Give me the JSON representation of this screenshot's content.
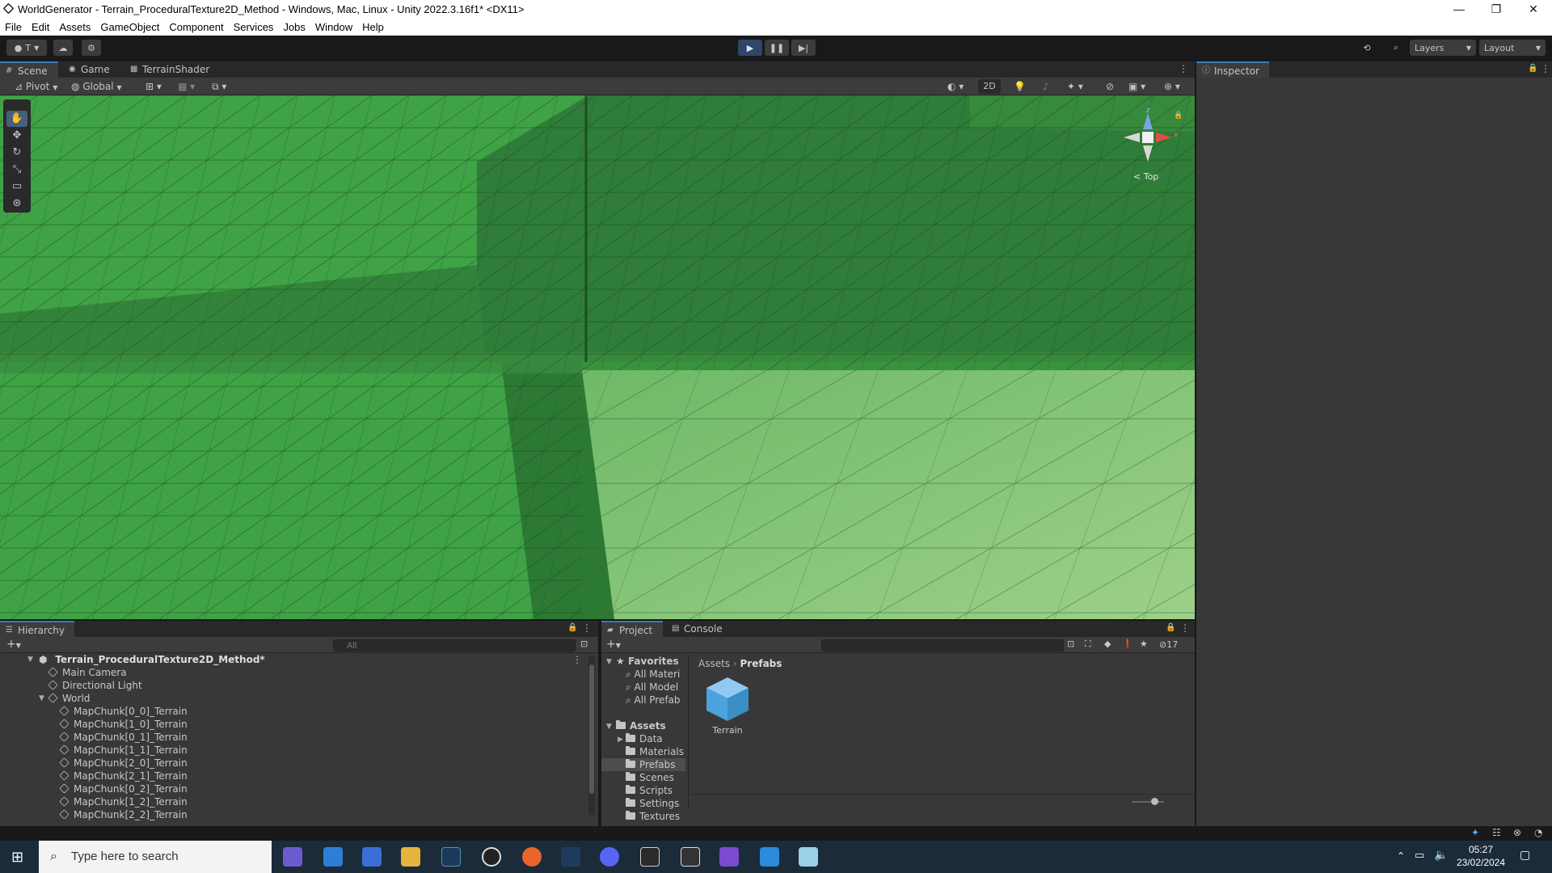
{
  "window": {
    "title": "WorldGenerator - Terrain_ProceduralTexture2D_Method - Windows, Mac, Linux - Unity 2022.3.16f1* <DX11>",
    "minimize_glyph": "—",
    "maximize_glyph": "❐",
    "close_glyph": "✕"
  },
  "menu": [
    "File",
    "Edit",
    "Assets",
    "GameObject",
    "Component",
    "Services",
    "Jobs",
    "Window",
    "Help"
  ],
  "toolbar": {
    "account_label": "T",
    "layers_label": "Layers",
    "layout_label": "Layout"
  },
  "scene_tabs": [
    {
      "label": "Scene",
      "icon": "#"
    },
    {
      "label": "Game",
      "icon": "◉"
    },
    {
      "label": "TerrainShader",
      "icon": "▦"
    }
  ],
  "scene_toolbar": {
    "pivot_label": "Pivot",
    "global_label": "Global",
    "mode_2d_label": "2D"
  },
  "gizmo": {
    "view_label": "Top",
    "axis_z": "z",
    "axis_x": "x"
  },
  "inspector": {
    "tab_label": "Inspector"
  },
  "hierarchy": {
    "tab_label": "Hierarchy",
    "search_placeholder": "All",
    "scene_name": "Terrain_ProceduralTexture2D_Method*",
    "items": [
      {
        "label": "Main Camera",
        "depth": 1
      },
      {
        "label": "Directional Light",
        "depth": 1
      },
      {
        "label": "World",
        "depth": 1
      },
      {
        "label": "MapChunk[0_0]_Terrain",
        "depth": 2
      },
      {
        "label": "MapChunk[1_0]_Terrain",
        "depth": 2
      },
      {
        "label": "MapChunk[0_1]_Terrain",
        "depth": 2
      },
      {
        "label": "MapChunk[1_1]_Terrain",
        "depth": 2
      },
      {
        "label": "MapChunk[2_0]_Terrain",
        "depth": 2
      },
      {
        "label": "MapChunk[2_1]_Terrain",
        "depth": 2
      },
      {
        "label": "MapChunk[0_2]_Terrain",
        "depth": 2
      },
      {
        "label": "MapChunk[1_2]_Terrain",
        "depth": 2
      },
      {
        "label": "MapChunk[2_2]_Terrain",
        "depth": 2
      }
    ]
  },
  "project": {
    "tab_label": "Project",
    "console_tab_label": "Console",
    "hidden_count": "17",
    "favorites_label": "Favorites",
    "favorites": [
      "All Materi",
      "All Model",
      "All Prefab"
    ],
    "assets_label": "Assets",
    "folders": [
      "Data",
      "Materials",
      "Prefabs",
      "Scenes",
      "Scripts",
      "Settings",
      "Textures"
    ],
    "selected_folder": "Prefabs",
    "breadcrumb": [
      "Assets",
      "Prefabs"
    ],
    "asset_items": [
      {
        "label": "Terrain"
      }
    ]
  },
  "taskbar": {
    "search_placeholder": "Type here to search",
    "time": "05:27",
    "date": "23/02/2024"
  }
}
